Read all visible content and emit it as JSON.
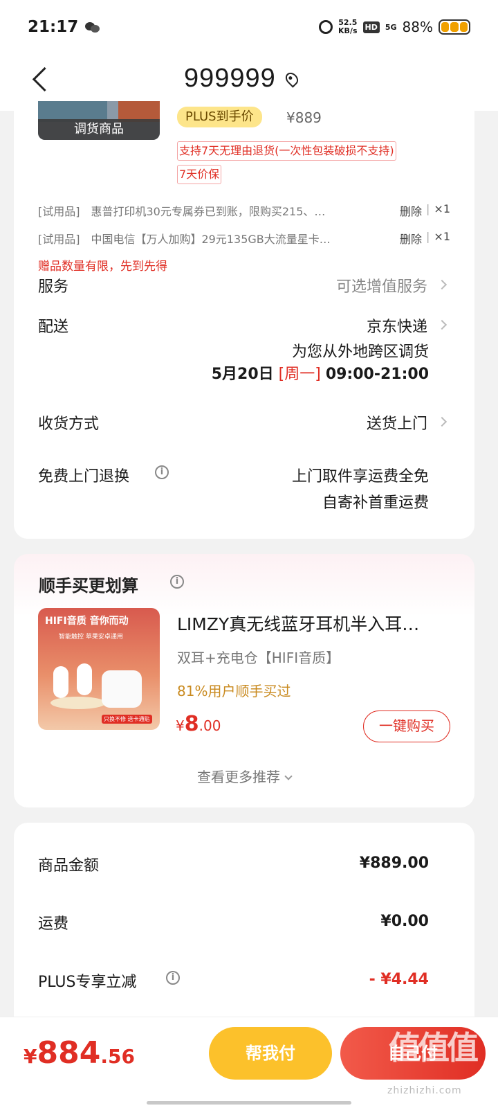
{
  "status_bar": {
    "time": "21:17",
    "net_speed_value": "52.5",
    "net_speed_unit": "KB/s",
    "hd": "HD",
    "network": "5G",
    "battery": "88%"
  },
  "header": {
    "title": "999999"
  },
  "product": {
    "thumb_label": "调货商品",
    "plus_badge": "PLUS到手价",
    "price": "¥889",
    "tag_return": "支持7天无理由退货(一次性包装破损不支持)",
    "tag_price_protect": "7天价保"
  },
  "gifts": [
    {
      "type": "[试用品]",
      "name": "惠普打印机30元专属券已到账，限购买215、…",
      "action": "删除",
      "qty": "×1"
    },
    {
      "type": "[试用品]",
      "name": "中国电信【万人加购】29元135GB大流量星卡…",
      "action": "删除",
      "qty": "×1"
    }
  ],
  "gift_notice": "赠品数量有限，先到先得",
  "service": {
    "label": "服务",
    "value": "可选增值服务"
  },
  "delivery": {
    "label": "配送",
    "carrier": "京东快递",
    "note": "为您从外地跨区调货",
    "date": "5月20日",
    "weekday": "[周一]",
    "time_window": "09:00-21:00"
  },
  "receive": {
    "label": "收货方式",
    "value": "送货上门"
  },
  "free_return": {
    "label": "免费上门退换",
    "line1": "上门取件享运费全免",
    "line2": "自寄补首重运费"
  },
  "recommend": {
    "title": "顺手买更划算",
    "image_text_top": "HIFI音质  音你而动",
    "image_text_sub": "智能触控  苹果安卓通用",
    "image_badge": "只换不修  送卡通贴",
    "item_title": "LIMZY真无线蓝牙耳机半入耳…",
    "item_spec": "双耳+充电仓【HIFI音质】",
    "item_social": "81%用户顺手买过",
    "price_symbol": "¥",
    "price_int": "8",
    "price_dec": ".00",
    "buy_button": "一键购买",
    "more": "查看更多推荐"
  },
  "summary": [
    {
      "label": "商品金额",
      "value": "¥889.00",
      "red": false,
      "info": false
    },
    {
      "label": "运费",
      "value": "¥0.00",
      "red": false,
      "info": false
    },
    {
      "label": "PLUS专享立减",
      "value": "- ¥4.44",
      "red": true,
      "info": true
    }
  ],
  "bottom": {
    "currency": "¥",
    "total_int": "884",
    "total_dec": ".56",
    "help_pay": "帮我付",
    "self_pay": "自己付",
    "watermark": "值值值",
    "watermark_url": "zhizhizhi.com"
  },
  "colors": {
    "accent_red": "#e02e24",
    "gold": "#fcc12b",
    "plus_badge_bg": "#fde58a"
  }
}
